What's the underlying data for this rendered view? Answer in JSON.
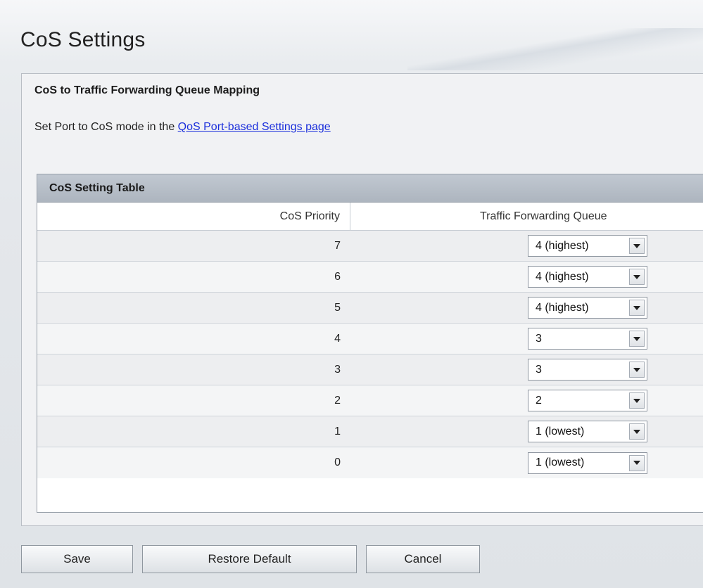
{
  "page": {
    "title": "CoS Settings"
  },
  "section": {
    "heading": "CoS to Traffic Forwarding Queue Mapping",
    "hint_text": "Set Port to CoS mode in the ",
    "hint_link": "QoS Port-based Settings page"
  },
  "table": {
    "caption": "CoS Setting Table",
    "col_priority": "CoS Priority",
    "col_queue": "Traffic Forwarding Queue",
    "rows": [
      {
        "priority": "7",
        "queue": "4 (highest)"
      },
      {
        "priority": "6",
        "queue": "4 (highest)"
      },
      {
        "priority": "5",
        "queue": "4 (highest)"
      },
      {
        "priority": "4",
        "queue": "3"
      },
      {
        "priority": "3",
        "queue": "3"
      },
      {
        "priority": "2",
        "queue": "2"
      },
      {
        "priority": "1",
        "queue": "1 (lowest)"
      },
      {
        "priority": "0",
        "queue": "1 (lowest)"
      }
    ]
  },
  "buttons": {
    "save": "Save",
    "restore": "Restore Default",
    "cancel": "Cancel"
  },
  "icons": {
    "dropdown": "chevron-down-icon"
  },
  "colors": {
    "link": "#1a2edb",
    "table_header": "#b3bbc5"
  }
}
